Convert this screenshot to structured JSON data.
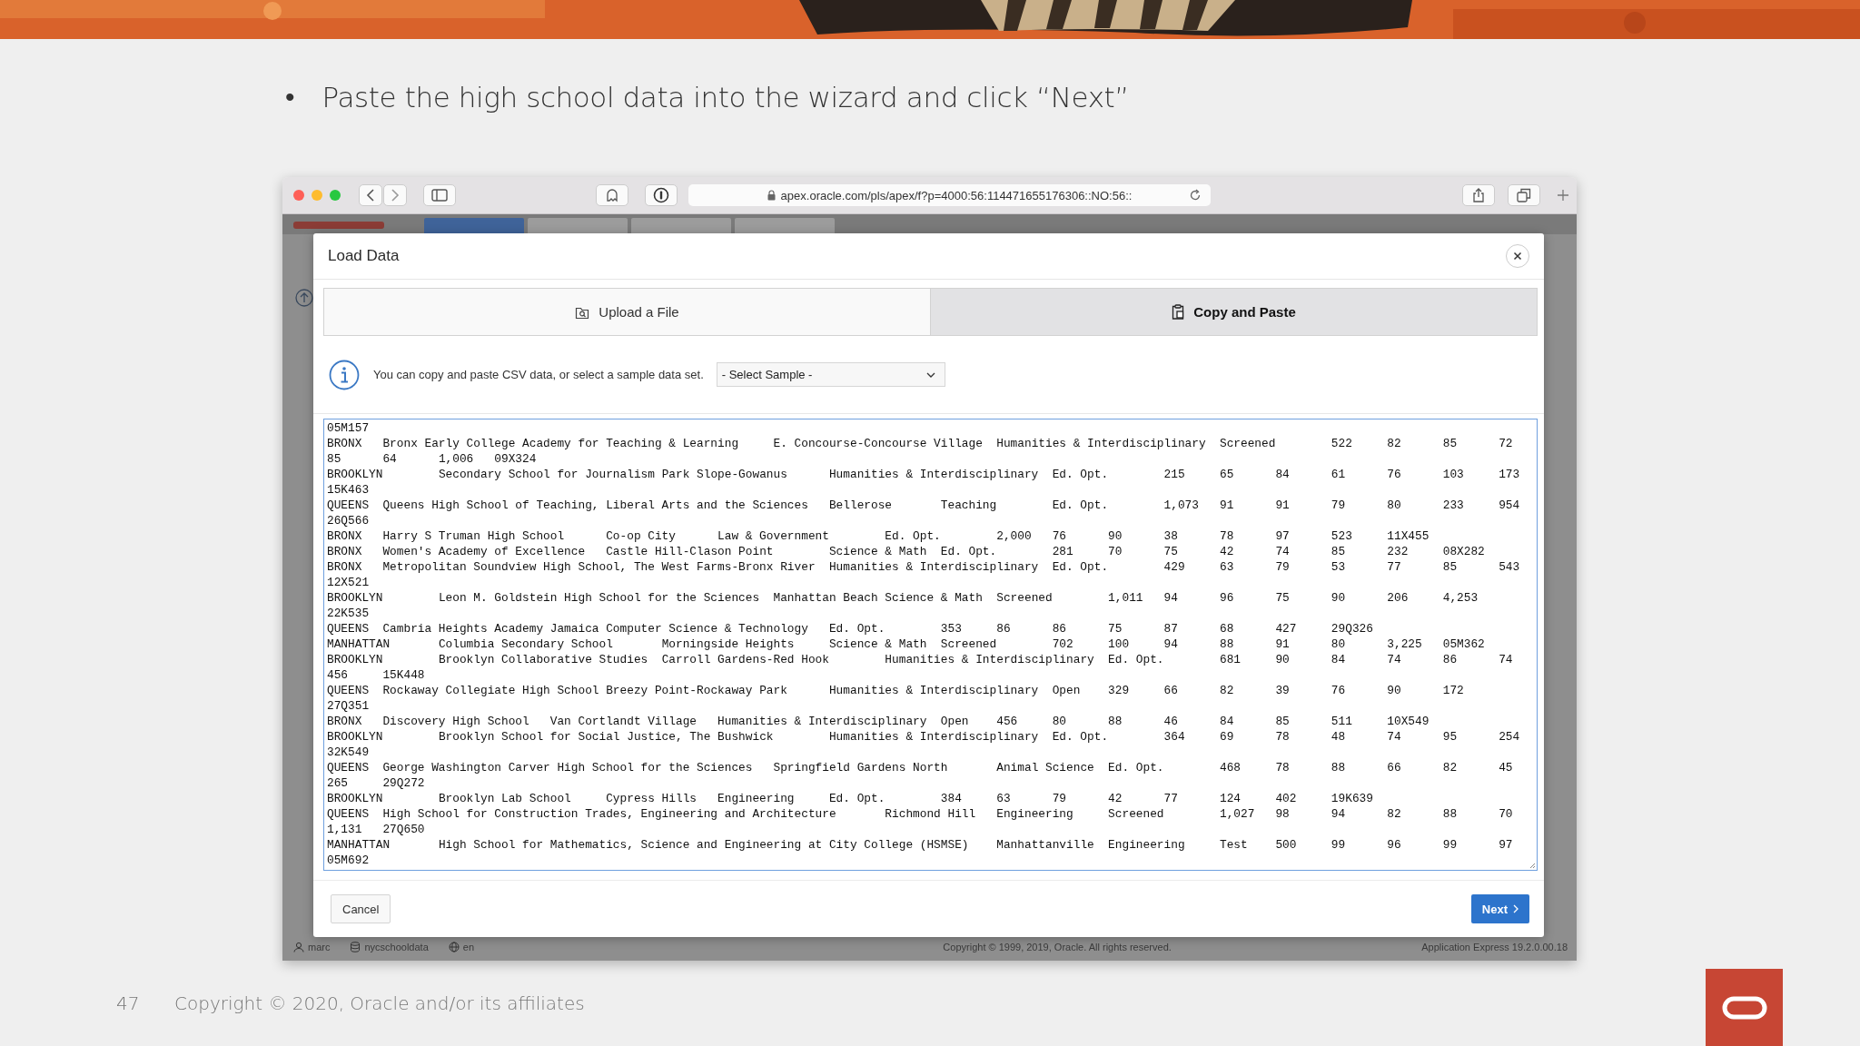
{
  "slide": {
    "bullet": "•",
    "text": "Paste the high school data into the wizard and click “Next”",
    "page_number": "47",
    "copyright": "Copyright © 2020, Oracle and/or its affiliates"
  },
  "browser": {
    "url": "apex.oracle.com/pls/apex/f?p=4000:56:114471655176306::NO:56::"
  },
  "app_header": {
    "tabs": [
      {
        "selected": true
      },
      {
        "selected": false
      },
      {
        "selected": false
      },
      {
        "selected": false
      }
    ]
  },
  "dialog": {
    "title": "Load Data",
    "tabs": [
      {
        "label": "Upload a File",
        "kind": "file",
        "selected": false
      },
      {
        "label": "Copy and Paste",
        "kind": "paste",
        "selected": true
      }
    ],
    "info": "You can copy and paste CSV data, or select a sample data set.",
    "select": {
      "value": "- Select Sample -"
    },
    "lines": [
      "05M157",
      "BRONX\tBronx Early College Academy for Teaching & Learning\tE. Concourse-Concourse Village\tHumanities & Interdisciplinary\tScreened\t522\t82\t85\t72",
      "85\t64\t1,006\t09X324",
      "BROOKLYN\tSecondary School for Journalism\tPark Slope-Gowanus\tHumanities & Interdisciplinary\tEd. Opt.\t215\t65\t84\t61\t76\t103\t173",
      "15K463",
      "QUEENS\tQueens High School of Teaching, Liberal Arts and the Sciences\tBellerose\tTeaching\tEd. Opt.\t1,073\t91\t91\t79\t80\t233\t954",
      "26Q566",
      "BRONX\tHarry S Truman High School\tCo-op City\tLaw & Government\tEd. Opt.\t2,000\t76\t90\t38\t78\t97\t523\t11X455",
      "BRONX\tWomen's Academy of Excellence\tCastle Hill-Clason Point\tScience & Math\tEd. Opt.\t281\t70\t75\t42\t74\t85\t232\t08X282",
      "BRONX\tMetropolitan Soundview High School, The West Farms-Bronx River\tHumanities & Interdisciplinary\tEd. Opt.\t429\t63\t79\t53\t77\t85\t543",
      "12X521",
      "BROOKLYN\tLeon M. Goldstein High School for the Sciences\tManhattan Beach\tScience & Math\tScreened\t1,011\t94\t96\t75\t90\t206\t4,253",
      "22K535",
      "QUEENS\tCambria Heights Academy\tJamaica\tComputer Science & Technology\tEd. Opt.\t353\t86\t86\t75\t87\t68\t427\t29Q326",
      "MANHATTAN\tColumbia Secondary School\tMorningside Heights\tScience & Math\tScreened\t702\t100\t94\t88\t91\t80\t3,225\t05M362",
      "BROOKLYN\tBrooklyn Collaborative Studies\tCarroll Gardens-Red Hook\tHumanities & Interdisciplinary\tEd. Opt.\t681\t90\t84\t74\t86\t74",
      "456\t15K448",
      "QUEENS\tRockaway Collegiate High School\tBreezy Point-Rockaway Park\tHumanities & Interdisciplinary\tOpen\t329\t66\t82\t39\t76\t90\t172",
      "27Q351",
      "BRONX\tDiscovery High School\tVan Cortlandt Village\tHumanities & Interdisciplinary\tOpen\t456\t80\t88\t46\t84\t85\t511\t10X549",
      "BROOKLYN\tBrooklyn School for Social Justice, The Bushwick\tHumanities & Interdisciplinary\tEd. Opt.\t364\t69\t78\t48\t74\t95\t254",
      "32K549",
      "QUEENS\tGeorge Washington Carver High School for the Sciences\tSpringfield Gardens North\tAnimal Science\tEd. Opt.\t468\t78\t88\t66\t82\t45",
      "265\t29Q272",
      "BROOKLYN\tBrooklyn Lab School\tCypress Hills\tEngineering\tEd. Opt.\t384\t63\t79\t42\t77\t124\t402\t19K639",
      "QUEENS\tHigh School for Construction Trades, Engineering and Architecture\tRichmond Hill\tEngineering\tScreened\t1,027\t98\t94\t82\t88\t70",
      "1,131\t27Q650",
      "MANHATTAN\tHigh School for Mathematics, Science and Engineering at City College (HSMSE)\tManhattanville\tEngineering\tTest\t500\t99\t96\t99\t97",
      "05M692"
    ],
    "buttons": {
      "cancel": "Cancel",
      "next": "Next"
    }
  },
  "app_footer": {
    "user": "marc",
    "schema": "nycschooldata",
    "language": "en",
    "copyright": "Copyright © 1999, 2019, Oracle. All rights reserved.",
    "version": "Application Express 19.2.0.00.18"
  }
}
